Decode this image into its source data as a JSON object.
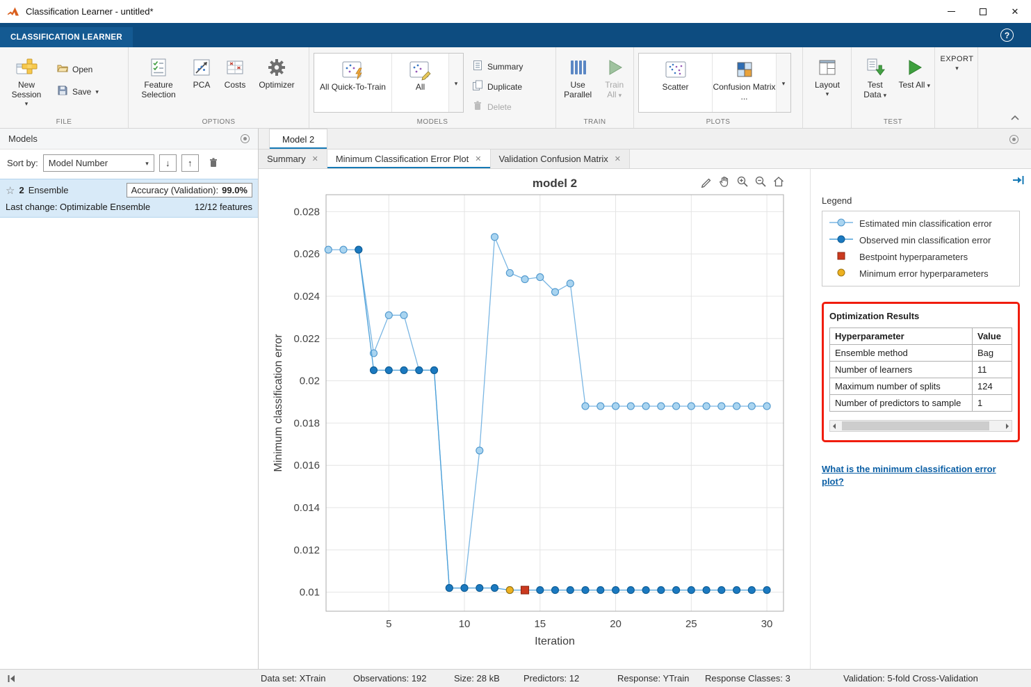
{
  "icons": {
    "caret": "▾",
    "close": "✕",
    "help": "?",
    "sort_desc": "↓",
    "sort_asc": "↑",
    "star": "☆"
  },
  "titlebar": {
    "title": "Classification Learner - untitled*"
  },
  "ribbon": {
    "tab_label": "CLASSIFICATION LEARNER",
    "file": {
      "group": "FILE",
      "new_session": "New Session",
      "open": "Open",
      "save": "Save"
    },
    "options": {
      "group": "OPTIONS",
      "feature_selection": "Feature Selection",
      "pca": "PCA",
      "costs": "Costs",
      "optimizer": "Optimizer"
    },
    "models": {
      "group": "MODELS",
      "all_quick": "All Quick-To-Train",
      "all": "All",
      "summary": "Summary",
      "duplicate": "Duplicate",
      "delete": "Delete"
    },
    "train": {
      "group": "TRAIN",
      "use_parallel": "Use Parallel",
      "train_all": "Train All"
    },
    "plots": {
      "group": "PLOTS",
      "scatter": "Scatter",
      "confusion_matrix": "Confusion Matrix ...",
      "layout": "Layout"
    },
    "test": {
      "group": "TEST",
      "test_data": "Test Data",
      "test_all": "Test All"
    },
    "export_label": "EXPORT"
  },
  "models_panel": {
    "title": "Models",
    "sort_label": "Sort by:",
    "sort_value": "Model Number",
    "model": {
      "number": "2",
      "type": "Ensemble",
      "accuracy_label": "Accuracy (Validation):",
      "accuracy_value": "99.0%",
      "last_change": "Last change: Optimizable Ensemble",
      "features": "12/12 features"
    }
  },
  "doc": {
    "tab": "Model 2",
    "subtabs": [
      "Summary",
      "Minimum Classification Error Plot",
      "Validation Confusion Matrix"
    ]
  },
  "legend": {
    "title": "Legend"
  },
  "optimization_results": {
    "title": "Optimization Results",
    "columns": [
      "Hyperparameter",
      "Value"
    ],
    "rows": [
      [
        "Ensemble method",
        "Bag"
      ],
      [
        "Number of learners",
        "11"
      ],
      [
        "Maximum number of splits",
        "124"
      ],
      [
        "Number of predictors to sample",
        "1"
      ]
    ]
  },
  "help_link": "What is the minimum classification error plot?",
  "statusbar": {
    "items": [
      "Data set: XTrain",
      "Observations: 192",
      "Size: 28 kB",
      "Predictors: 12",
      "Response: YTrain",
      "Response Classes: 3",
      "Validation: 5-fold Cross-Validation"
    ]
  },
  "chart_data": {
    "type": "line",
    "title": "model 2",
    "xlabel": "Iteration",
    "ylabel": "Minimum classification error",
    "xlim": [
      0.85,
      31.1
    ],
    "ylim": [
      0.0091,
      0.0288
    ],
    "xticks": [
      5,
      10,
      15,
      20,
      25,
      30
    ],
    "yticks": [
      0.01,
      0.012,
      0.014,
      0.016,
      0.018,
      0.02,
      0.022,
      0.024,
      0.026,
      0.028
    ],
    "grid": true,
    "legend_position": "outside-right",
    "x": [
      1,
      2,
      3,
      4,
      5,
      6,
      7,
      8,
      9,
      10,
      11,
      12,
      13,
      14,
      15,
      16,
      17,
      18,
      19,
      20,
      21,
      22,
      23,
      24,
      25,
      26,
      27,
      28,
      29,
      30
    ],
    "series": [
      {
        "name": "Estimated min classification error",
        "type": "line+marker",
        "line_color": "#7ab6e3",
        "marker_fill": "#a9d4f0",
        "marker_stroke": "#4e97cd",
        "values": [
          0.0262,
          0.0262,
          0.0262,
          0.0213,
          0.0231,
          0.0231,
          0.0205,
          0.0205,
          0.0102,
          0.0102,
          0.0167,
          0.0268,
          0.0251,
          0.0248,
          0.0249,
          0.0242,
          0.0246,
          0.0188,
          0.0188,
          0.0188,
          0.0188,
          0.0188,
          0.0188,
          0.0188,
          0.0188,
          0.0188,
          0.0188,
          0.0188,
          0.0188,
          0.0188
        ]
      },
      {
        "name": "Observed min classification error",
        "type": "line+marker",
        "line_color": "#4a9fd8",
        "marker_fill": "#1b79c0",
        "marker_stroke": "#0d5c94",
        "values": [
          null,
          null,
          0.0262,
          0.0205,
          0.0205,
          0.0205,
          0.0205,
          0.0205,
          0.0102,
          0.0102,
          0.0102,
          0.0102,
          0.0101,
          0.0101,
          0.0101,
          0.0101,
          0.0101,
          0.0101,
          0.0101,
          0.0101,
          0.0101,
          0.0101,
          0.0101,
          0.0101,
          0.0101,
          0.0101,
          0.0101,
          0.0101,
          0.0101,
          0.0101
        ]
      },
      {
        "name": "Bestpoint hyperparameters",
        "type": "point",
        "marker": "square",
        "marker_fill": "#cb3a1f",
        "marker_stroke": "#8c2510",
        "points": [
          [
            14,
            0.0101
          ]
        ]
      },
      {
        "name": "Minimum error hyperparameters",
        "type": "point",
        "marker": "circle",
        "marker_fill": "#edb120",
        "marker_stroke": "#9c7410",
        "points": [
          [
            13,
            0.0101
          ]
        ]
      }
    ]
  }
}
